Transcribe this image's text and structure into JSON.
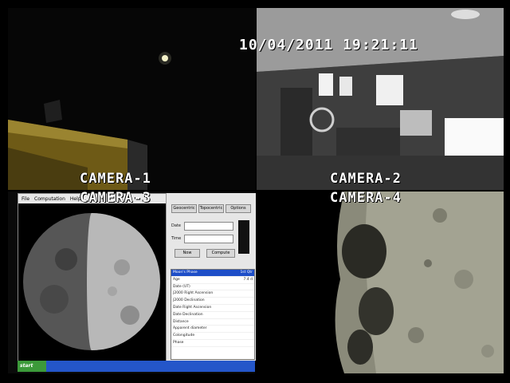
{
  "osd": {
    "datetime": "10/04/2011 19:21:11"
  },
  "cameras": {
    "c1": {
      "label": "CAMERA-1"
    },
    "c2": {
      "label": "CAMERA-2"
    },
    "c3": {
      "label": "CAMERA-3"
    },
    "c4": {
      "label": "CAMERA-4"
    }
  },
  "screen": {
    "menu": [
      "File",
      "Computation",
      "Help"
    ],
    "panel_labels": [
      "Date",
      "Time"
    ],
    "panel_buttons": [
      "Now",
      "Compute"
    ],
    "panel_tabs": [
      "Geocentric",
      "Topocentric",
      "Options"
    ],
    "taskbar_start": "start",
    "table_rows": [
      [
        "Moon's Phase",
        "1st Qtr"
      ],
      [
        "Age",
        "7.4 d"
      ],
      [
        "Date (UT)",
        ""
      ],
      [
        "J2000 Right Ascension",
        ""
      ],
      [
        "J2000 Declination",
        ""
      ],
      [
        "Date Right Ascension",
        ""
      ],
      [
        "Date Declination",
        ""
      ],
      [
        "Distance",
        ""
      ],
      [
        "Apparent diameter",
        ""
      ],
      [
        "Colongitude",
        ""
      ],
      [
        "Phase",
        ""
      ]
    ]
  },
  "colors": {
    "selection": "#1e4ec8",
    "taskbar": "#2456c9",
    "osd": "#ffffff"
  }
}
